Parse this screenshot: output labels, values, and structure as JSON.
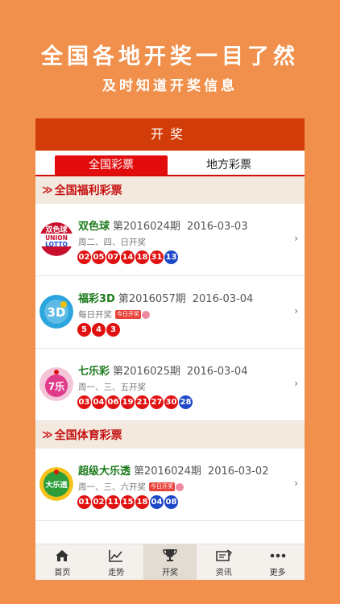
{
  "promo": {
    "title": "全国各地开奖一目了然",
    "subtitle": "及时知道开奖信息"
  },
  "header": {
    "title": "开奖"
  },
  "tabs": [
    {
      "label": "全国彩票",
      "active": true
    },
    {
      "label": "地方彩票",
      "active": false
    }
  ],
  "sections": [
    {
      "label": "全国福利彩票"
    },
    {
      "label": "全国体育彩票"
    }
  ],
  "lotteries": [
    {
      "name": "双色球",
      "period": "第2016024期",
      "date": "2016-03-03",
      "schedule": "周二、四、日开奖",
      "logo_text": "双色球",
      "logo_text2": "UNION",
      "logo_text3": "LOTTO",
      "red": [
        "02",
        "05",
        "07",
        "14",
        "18",
        "31"
      ],
      "blue": [
        "13"
      ]
    },
    {
      "name": "福彩3D",
      "period": "第2016057期",
      "date": "2016-03-04",
      "schedule": "每日开奖",
      "badge": "今日开奖",
      "logo_text": "3D",
      "red": [
        "5",
        "4",
        "3"
      ],
      "blue": []
    },
    {
      "name": "七乐彩",
      "period": "第2016025期",
      "date": "2016-03-04",
      "schedule": "周一、三、五开奖",
      "logo_text": "7乐",
      "red": [
        "03",
        "04",
        "06",
        "19",
        "21",
        "27",
        "30"
      ],
      "blue": [
        "28"
      ]
    },
    {
      "name": "超级大乐透",
      "period": "第2016024期",
      "date": "2016-03-02",
      "schedule": "周一、三、六开奖",
      "badge": "今日开奖",
      "logo_text": "大乐透",
      "red": [
        "01",
        "02",
        "11",
        "15",
        "18"
      ],
      "blue": [
        "04",
        "08"
      ]
    }
  ],
  "nav": [
    {
      "label": "首页",
      "icon": "home-icon"
    },
    {
      "label": "走势",
      "icon": "trend-chart-icon"
    },
    {
      "label": "开奖",
      "icon": "trophy-icon",
      "active": true
    },
    {
      "label": "资讯",
      "icon": "news-icon"
    },
    {
      "label": "更多",
      "icon": "more-dots-icon"
    }
  ],
  "colors": {
    "background": "#F0904C",
    "header": "#D23C08",
    "red_ball": "#E11111",
    "blue_ball": "#1E48C8",
    "name_green": "#1C7A1C"
  }
}
